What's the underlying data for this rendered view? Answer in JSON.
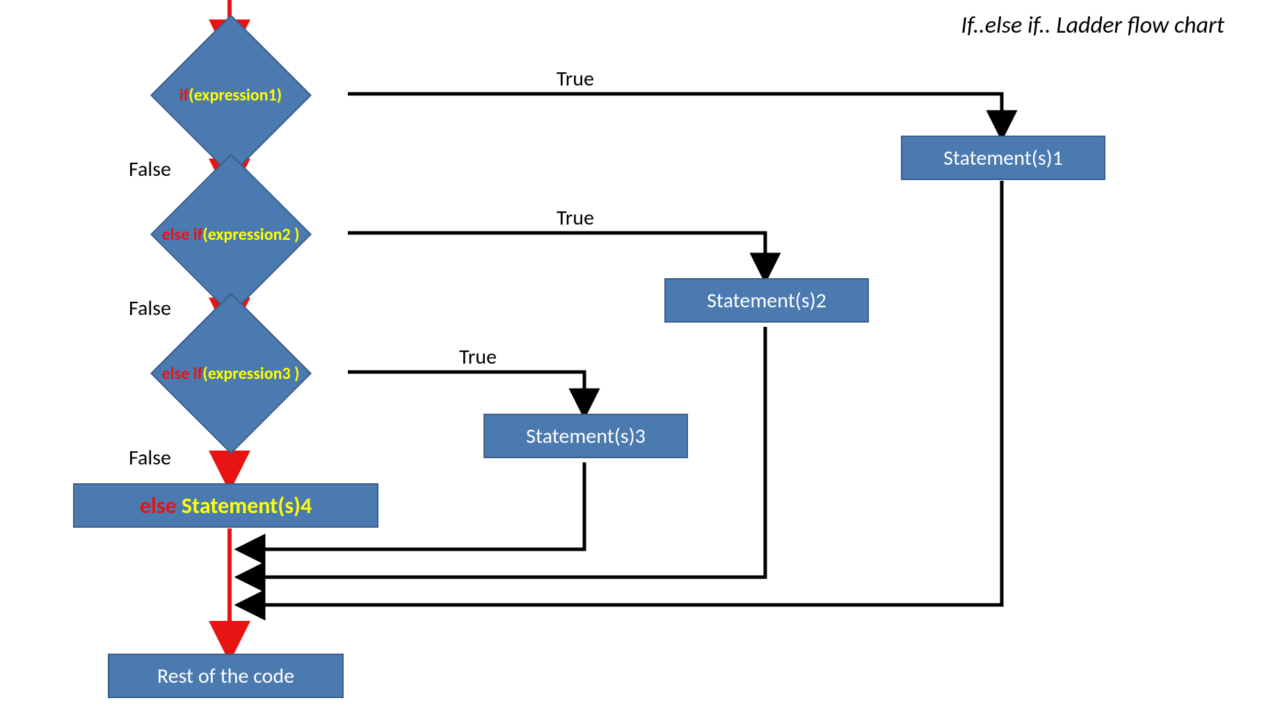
{
  "title": "If..else if.. Ladder flow chart",
  "nodes": {
    "d1": {
      "kw": "if",
      "expr": "(expression1)"
    },
    "d2": {
      "kw": "else if",
      "expr": "(expression2 )"
    },
    "d3": {
      "kw": "else if",
      "expr": "(expression3 )"
    },
    "s1": "Statement(s)1",
    "s2": "Statement(s)2",
    "s3": "Statement(s)3",
    "elseBox": {
      "kw": "else",
      "stmt": " Statement(s)4"
    },
    "rest": "Rest of the code"
  },
  "labels": {
    "true": "True",
    "false": "False"
  }
}
